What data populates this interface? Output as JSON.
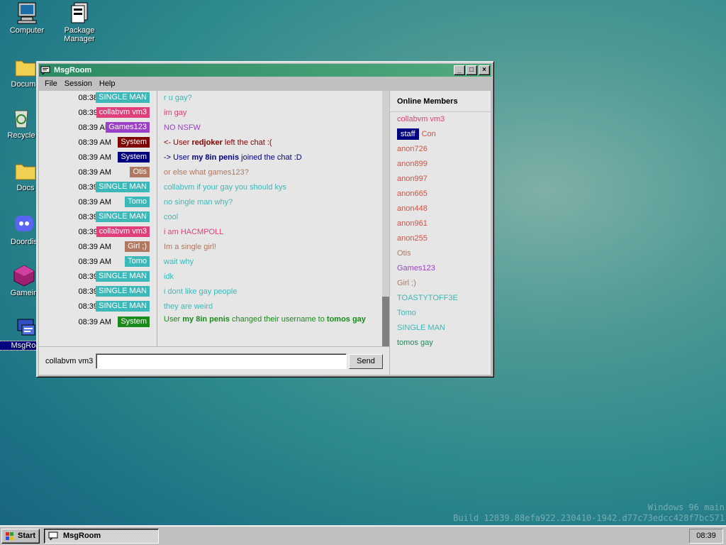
{
  "desktop": {
    "icons": [
      {
        "label": "Computer",
        "icon": "computer-icon"
      },
      {
        "label": "Package Manager",
        "icon": "package-manager-icon"
      },
      {
        "label": "Docume",
        "icon": "folder-icon"
      },
      {
        "label": "Recycle",
        "icon": "recycle-bin-icon"
      },
      {
        "label": "Docs",
        "icon": "folder-icon"
      },
      {
        "label": "Doordis",
        "icon": "discord-icon"
      },
      {
        "label": "Gamein",
        "icon": "game-icon"
      },
      {
        "label": "MsgRoo",
        "icon": "msgroom-icon"
      }
    ],
    "watermark_line1": "Windows 96 main",
    "watermark_line2": "Build 12839.88efa922.230410-1942.d77c73edcc428f7bc571"
  },
  "window": {
    "title": "MsgRoom",
    "menu": [
      "File",
      "Session",
      "Help"
    ],
    "title_buttons": [
      "_",
      "□",
      "×"
    ]
  },
  "messages": [
    {
      "time": "08:38 AM",
      "user": "SINGLE MAN",
      "user_color": "#3cb8b8",
      "text": "r u gay?",
      "text_color": "#3cb8b8"
    },
    {
      "time": "08:39 AM",
      "user": "collabvm vm3",
      "user_color": "#e0407a",
      "text": "im gay",
      "text_color": "#e0407a"
    },
    {
      "time": "08:39 AM",
      "user": "Games123",
      "user_color": "#9a3fc8",
      "text": "NO NSFW",
      "text_color": "#9a3fc8"
    },
    {
      "time": "08:39 AM",
      "user": "System",
      "user_color": "#800000",
      "system": "left",
      "pre": "<- User ",
      "bold": "redjoker",
      "post": " left the chat :(",
      "text_color": "#800000"
    },
    {
      "time": "08:39 AM",
      "user": "System",
      "user_color": "#000080",
      "system": "join",
      "pre": "-> User ",
      "bold": "my 8in penis",
      "post": " joined the chat :D",
      "text_color": "#000080"
    },
    {
      "time": "08:39 AM",
      "user": "Otis",
      "user_color": "#b07860",
      "text": "or else what games123?",
      "text_color": "#b07860"
    },
    {
      "time": "08:39 AM",
      "user": "SINGLE MAN",
      "user_color": "#3cb8b8",
      "text": "collabvm if your gay you should kys",
      "text_color": "#3cb8b8"
    },
    {
      "time": "08:39 AM",
      "user": "Tomo",
      "user_color": "#3cb8b8",
      "text": "no single man why?",
      "text_color": "#3cb8b8"
    },
    {
      "time": "08:39 AM",
      "user": "SINGLE MAN",
      "user_color": "#3cb8b8",
      "text": "cool",
      "text_color": "#3cb8b8"
    },
    {
      "time": "08:39 AM",
      "user": "collabvm vm3",
      "user_color": "#e0407a",
      "text": "i am HACMPOLL",
      "text_color": "#e0407a"
    },
    {
      "time": "08:39 AM",
      "user": "Girl ;)",
      "user_color": "#b07860",
      "text": "Im a single girl!",
      "text_color": "#b07860"
    },
    {
      "time": "08:39 AM",
      "user": "Tomo",
      "user_color": "#3cb8b8",
      "text": "wait why",
      "text_color": "#3cb8b8"
    },
    {
      "time": "08:39 AM",
      "user": "SINGLE MAN",
      "user_color": "#3cb8b8",
      "text": "idk",
      "text_color": "#3cb8b8"
    },
    {
      "time": "08:39 AM",
      "user": "SINGLE MAN",
      "user_color": "#3cb8b8",
      "text": "i dont like gay people",
      "text_color": "#3cb8b8"
    },
    {
      "time": "08:39 AM",
      "user": "SINGLE MAN",
      "user_color": "#3cb8b8",
      "text": "they are weird",
      "text_color": "#3cb8b8"
    },
    {
      "time": "08:39 AM",
      "user": "System",
      "user_color": "#1a8a1a",
      "system": "rename",
      "pre": "User ",
      "bold": "my 8in penis",
      "post": " changed their username to ",
      "bold2": "tomos gay",
      "text_color": "#1a8a1a"
    }
  ],
  "input": {
    "username": "collabvm vm3",
    "value": "",
    "send_label": "Send"
  },
  "members": {
    "header": "Online Members",
    "list": [
      {
        "name": "collabvm vm3",
        "color": "#e0407a"
      },
      {
        "tag": "staff",
        "name": "Con",
        "color": "#e04a3a"
      },
      {
        "name": "anon726",
        "color": "#e04a3a"
      },
      {
        "name": "anon899",
        "color": "#e04a3a"
      },
      {
        "name": "anon997",
        "color": "#e04a3a"
      },
      {
        "name": "anon665",
        "color": "#e04a3a"
      },
      {
        "name": "anon448",
        "color": "#e04a3a"
      },
      {
        "name": "anon961",
        "color": "#e04a3a"
      },
      {
        "name": "anon255",
        "color": "#e04a3a"
      },
      {
        "name": "Otis",
        "color": "#b07860"
      },
      {
        "name": "Games123",
        "color": "#9a3fc8"
      },
      {
        "name": "Girl ;)",
        "color": "#b07860"
      },
      {
        "name": "TOASTYTOFF3E",
        "color": "#3cb8b8"
      },
      {
        "name": "Tomo",
        "color": "#3cb8b8"
      },
      {
        "name": "SINGLE MAN",
        "color": "#3cb8b8"
      },
      {
        "name": "tomos gay",
        "color": "#1a8a5a"
      }
    ]
  },
  "taskbar": {
    "start_label": "Start",
    "task_label": "MsgRoom",
    "clock": "08:39"
  }
}
